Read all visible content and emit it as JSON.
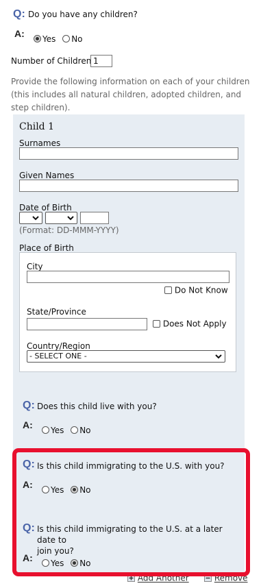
{
  "children_question": {
    "q_marker": "Q:",
    "text": "Do you have any children?",
    "a_marker": "A:",
    "yes": "Yes",
    "no": "No",
    "selected": "Yes"
  },
  "num_children": {
    "label": "Number of Children:",
    "value": "1"
  },
  "instructions": "Provide the following information on each of your children (this includes all natural children, adopted children, and step children).",
  "child": {
    "title": "Child 1",
    "surnames_label": "Surnames",
    "surnames_value": "",
    "given_names_label": "Given Names",
    "given_names_value": "",
    "dob_label": "Date of Birth",
    "dob_day": "",
    "dob_month": "",
    "dob_year": "",
    "dob_format": "(Format: DD-MMM-YYYY)",
    "pob_label": "Place of Birth",
    "city_label": "City",
    "city_value": "",
    "do_not_know": "Do Not Know",
    "state_label": "State/Province",
    "state_value": "",
    "does_not_apply": "Does Not Apply",
    "country_label": "Country/Region",
    "country_value": "- SELECT ONE -"
  },
  "live_with": {
    "q_marker": "Q:",
    "text": "Does this child live with you?",
    "a_marker": "A:",
    "yes": "Yes",
    "no": "No",
    "selected": ""
  },
  "immigrating_with": {
    "q_marker": "Q:",
    "text": "Is this child immigrating to the U.S. with you?",
    "a_marker": "A:",
    "yes": "Yes",
    "no": "No",
    "selected": "No"
  },
  "immigrating_later": {
    "q_marker": "Q:",
    "text_line1": "Is this child immigrating to the U.S. at a later date to",
    "text_line2": "join you?",
    "a_marker": "A:",
    "yes": "Yes",
    "no": "No",
    "selected": "No"
  },
  "actions": {
    "add": "Add Another",
    "remove": "Remove"
  },
  "colors": {
    "highlight": "#e8102e",
    "panel": "#e7edf3",
    "q_marker": "#4a64a8"
  }
}
